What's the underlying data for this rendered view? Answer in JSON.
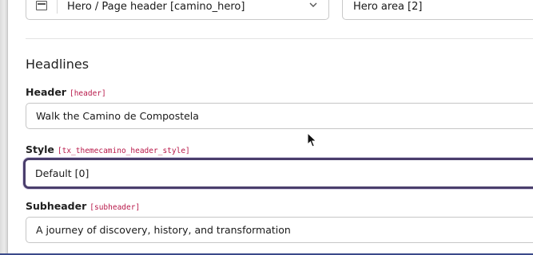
{
  "top_row": {
    "type_select": {
      "value": "Hero / Page header [camino_hero]"
    },
    "colpos_select": {
      "value": "Hero area [2]"
    }
  },
  "section": {
    "title": "Headlines"
  },
  "fields": {
    "header": {
      "label": "Header",
      "field_name": "[header]",
      "value": "Walk the Camino de Compostela"
    },
    "style": {
      "label": "Style",
      "field_name": "[tx_themecamino_header_style]",
      "value": "Default [0]"
    },
    "subheader": {
      "label": "Subheader",
      "field_name": "[subheader]",
      "value": "A journey of discovery, history, and transformation"
    }
  },
  "colors": {
    "field_name": "#b8194a",
    "focus_border": "#4a3e6c",
    "input_border": "#c6c6c6"
  },
  "icons": [
    "content-element-icon",
    "chevron-down-icon",
    "mouse-cursor-icon"
  ]
}
